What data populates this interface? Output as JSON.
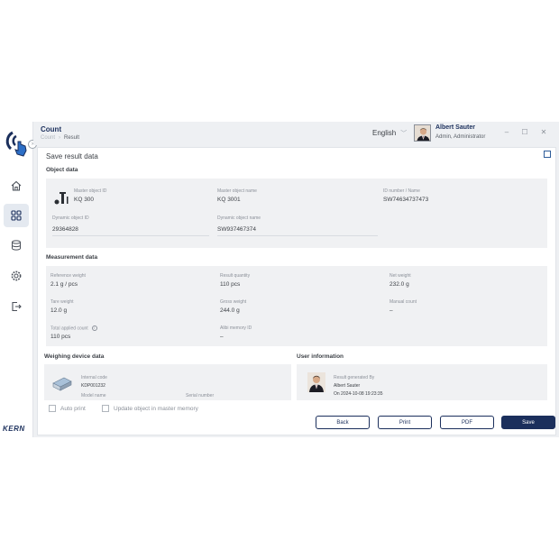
{
  "header": {
    "title": "Count",
    "breadcrumb": [
      "Count",
      "Result"
    ],
    "language": "English",
    "user_name": "Albert Sauter",
    "user_role": "Admin, Administrator"
  },
  "sidebar": {
    "brand": "KERN",
    "items": [
      {
        "icon": "home-icon",
        "active": false
      },
      {
        "icon": "grid-icon",
        "active": true
      },
      {
        "icon": "database-icon",
        "active": false
      },
      {
        "icon": "gear-icon",
        "active": false
      },
      {
        "icon": "logout-icon",
        "active": false
      }
    ]
  },
  "dialog": {
    "title": "Save result data",
    "object_data": {
      "heading": "Object data",
      "master_object_id_label": "Master object ID",
      "master_object_id": "KQ 300",
      "master_object_name_label": "Master object name",
      "master_object_name": "KQ 3001",
      "id_number_label": "ID number / Name",
      "id_number": "SW74634737473",
      "dynamic_object_id_label": "Dynamic object ID",
      "dynamic_object_id": "29364828",
      "dynamic_object_name_label": "Dynamic object name",
      "dynamic_object_name": "SW937467374"
    },
    "measurement": {
      "heading": "Measurement data",
      "reference_weight_label": "Reference weight",
      "reference_weight": "2.1 g / pcs",
      "result_quantity_label": "Result quantity",
      "result_quantity": "110 pcs",
      "net_weight_label": "Net weight",
      "net_weight": "232.0 g",
      "tare_weight_label": "Tare weight",
      "tare_weight": "12.0 g",
      "gross_weight_label": "Gross weight",
      "gross_weight": "244.0 g",
      "manual_count_label": "Manual count",
      "manual_count": "–",
      "total_applied_count_label": "Total applied count",
      "total_applied_count": "110 pcs",
      "alibi_memory_id_label": "Alibi memory ID",
      "alibi_memory_id": "–"
    },
    "device": {
      "heading": "Weighing device data",
      "internal_code_label": "Internal code",
      "internal_code": "KDP001232",
      "model_name_label": "Model name",
      "serial_number_label": "Serial number"
    },
    "user_info": {
      "heading": "User information",
      "generated_by_label": "Result generated By",
      "generated_by": "Albert Sauter",
      "generated_on": "On 2024-10-08 19:23:35"
    },
    "options": {
      "auto_print": "Auto print",
      "update_object": "Update object in master memory"
    },
    "buttons": {
      "back": "Back",
      "print": "Print",
      "pdf": "PDF",
      "save": "Save"
    }
  },
  "colors": {
    "primary": "#1b2f5c",
    "panel": "#f0f1f3",
    "background": "#eef0f3"
  }
}
